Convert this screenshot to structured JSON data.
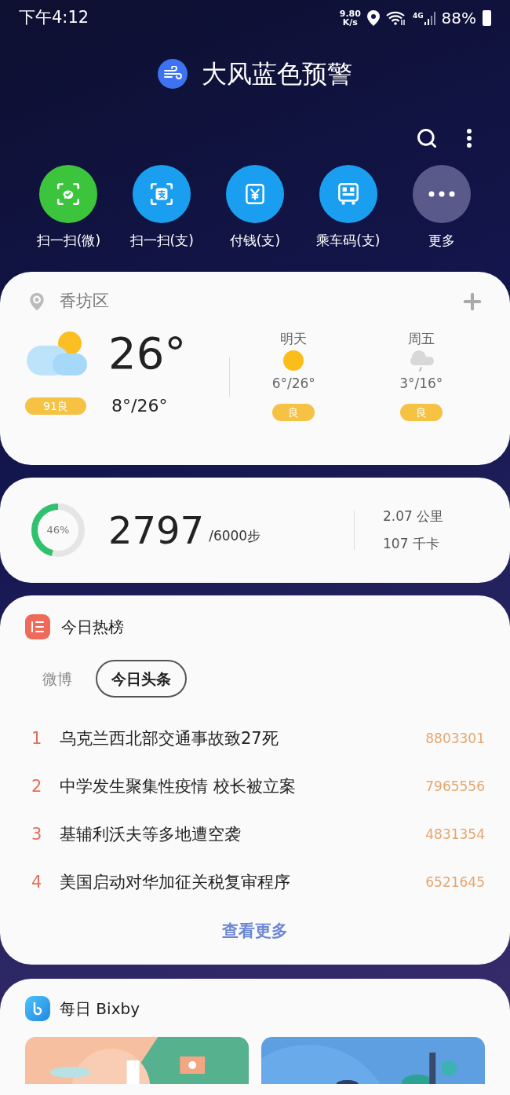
{
  "status_bar": {
    "time": "下午4:12",
    "speed_value": "9.80",
    "speed_unit": "K/s",
    "network": "4G",
    "battery": "88%"
  },
  "alert": {
    "title": "大风蓝色预警"
  },
  "shortcuts": [
    {
      "kind": "wechat-scan",
      "label": "扫一扫(微)"
    },
    {
      "kind": "alipay-scan",
      "label": "扫一扫(支)"
    },
    {
      "kind": "pay",
      "label": "付钱(支)"
    },
    {
      "kind": "bus-code",
      "label": "乘车码(支)"
    },
    {
      "kind": "more",
      "label": "更多"
    }
  ],
  "weather": {
    "location": "香坊区",
    "current": {
      "kind": "partly-cloudy",
      "temp": "26°",
      "range": "8°/26°",
      "aqi": "91良"
    },
    "forecast": [
      {
        "day": "明天",
        "kind": "sunny",
        "range": "6°/26°",
        "aqi": "良"
      },
      {
        "day": "周五",
        "kind": "rain",
        "range": "3°/16°",
        "aqi": "良"
      }
    ]
  },
  "steps": {
    "level": 0.46,
    "percent": "46%",
    "count": "2797",
    "goal": "/6000步",
    "distance": "2.07 公里",
    "calories": "107 千卡"
  },
  "hot_list": {
    "title": "今日热榜",
    "tabs": [
      {
        "label": "微博",
        "selected": false
      },
      {
        "label": "今日头条",
        "selected": true
      }
    ],
    "items": [
      {
        "rank": "1",
        "title": "乌克兰西北部交通事故致27死",
        "count": "8803301"
      },
      {
        "rank": "2",
        "title": "中学发生聚集性疫情 校长被立案",
        "count": "7965556"
      },
      {
        "rank": "3",
        "title": "基辅利沃夫等多地遭空袭",
        "count": "4831354"
      },
      {
        "rank": "4",
        "title": "美国启动对华加征关税复审程序",
        "count": "6521645"
      }
    ],
    "more": "查看更多"
  },
  "bixby": {
    "title": "每日 Bixby"
  }
}
